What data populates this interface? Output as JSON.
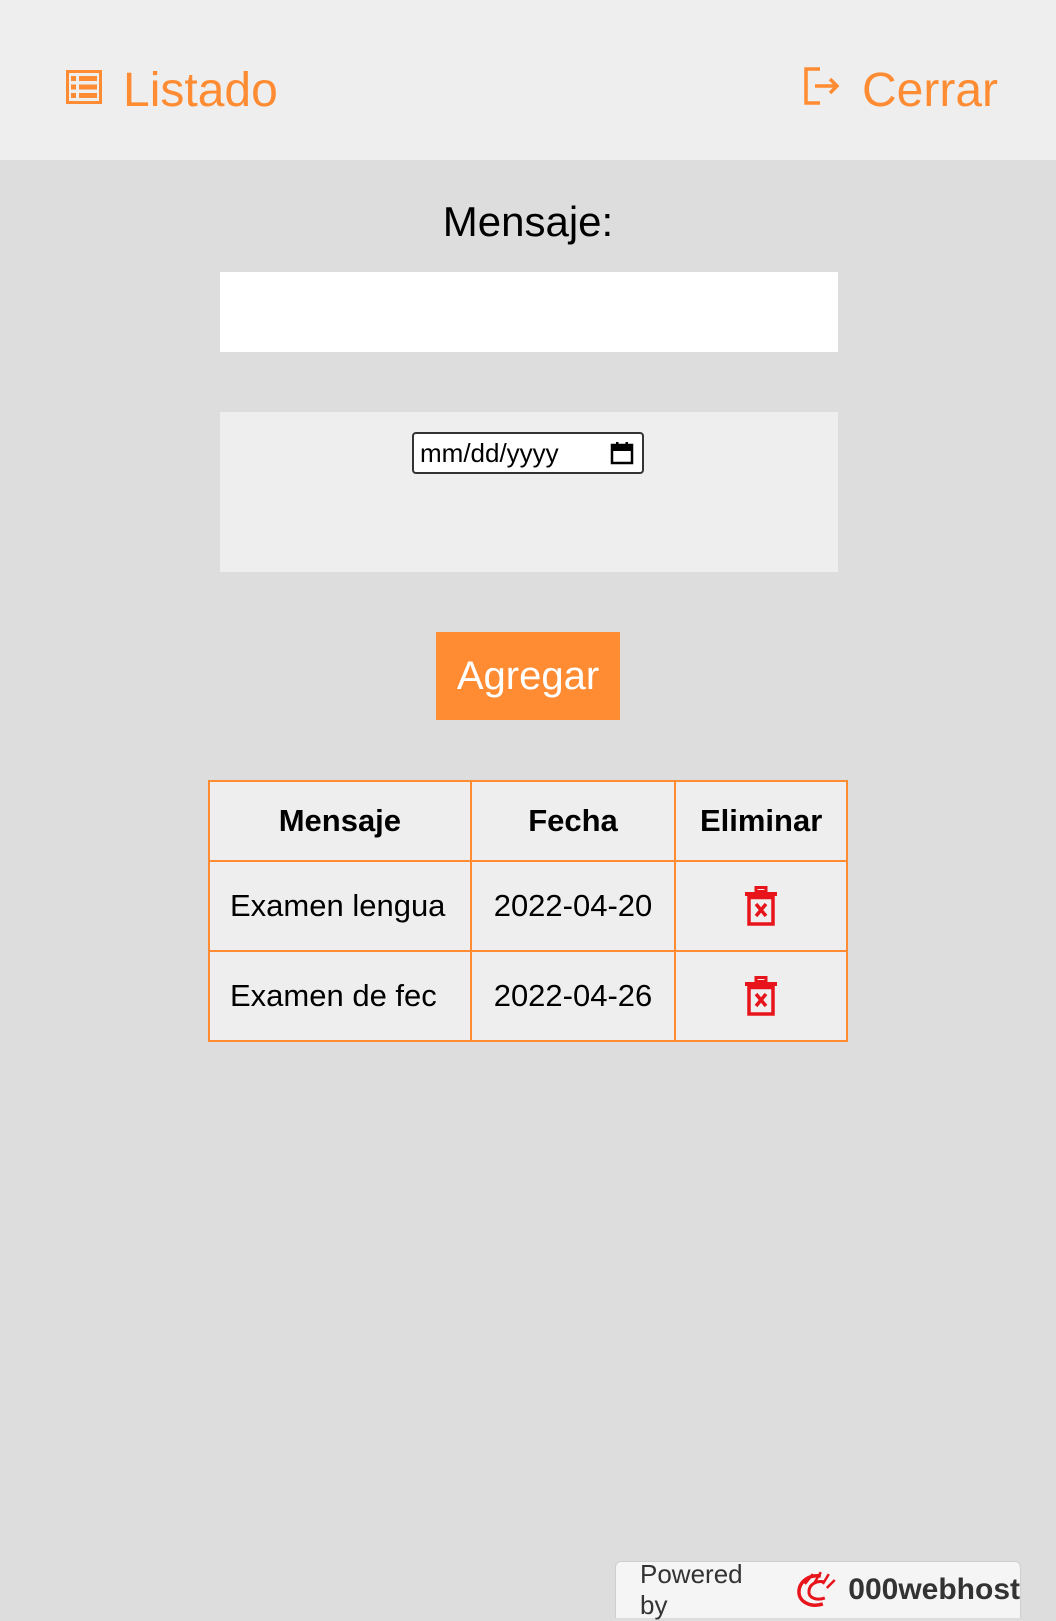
{
  "nav": {
    "listado_label": "Listado",
    "cerrar_label": "Cerrar",
    "listado_icon": "list-icon",
    "cerrar_icon": "logout-icon"
  },
  "form": {
    "title": "Mensaje:",
    "message_value": "",
    "date_placeholder": "mm/dd/yyyy",
    "add_label": "Agregar"
  },
  "table": {
    "headers": [
      "Mensaje",
      "Fecha",
      "Eliminar"
    ],
    "rows": [
      {
        "mensaje": "Examen lengua",
        "fecha": "2022-04-20",
        "delete_icon": "trash-icon"
      },
      {
        "mensaje": "Examen de fec",
        "fecha": "2022-04-26",
        "delete_icon": "trash-icon"
      }
    ]
  },
  "footer": {
    "powered_by": "Powered by",
    "brand": "000webhost"
  },
  "colors": {
    "accent": "#ff8c33",
    "delete": "#e8141b",
    "background": "#dddddd",
    "panel": "#eeeeee"
  }
}
